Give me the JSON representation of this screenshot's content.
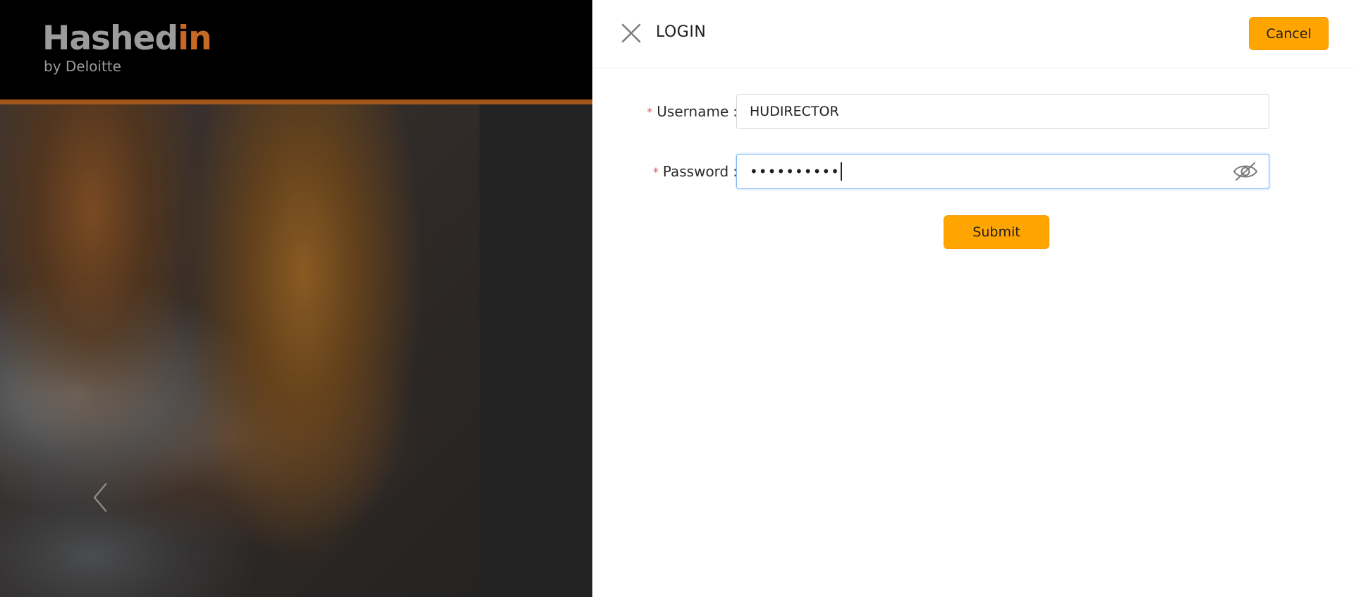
{
  "brand": {
    "name_prefix": "Hashed",
    "name_accent": "in",
    "subtitle": "by Deloitte"
  },
  "carousel": {
    "prev_icon": "chevron-left-icon"
  },
  "drawer": {
    "title": "LOGIN",
    "close_icon": "close-icon",
    "cancel_label": "Cancel"
  },
  "form": {
    "username": {
      "label": "Username",
      "required_mark": "*",
      "value": "HUDIRECTOR"
    },
    "password": {
      "label": "Password",
      "required_mark": "*",
      "masked_value": "••••••••••",
      "toggle_icon": "eye-off-icon"
    },
    "submit_label": "Submit"
  },
  "colors": {
    "accent": "#ffa502",
    "brand_orange": "#c46a26",
    "required": "#e84a4a",
    "focus_border": "#7ab6f2"
  }
}
